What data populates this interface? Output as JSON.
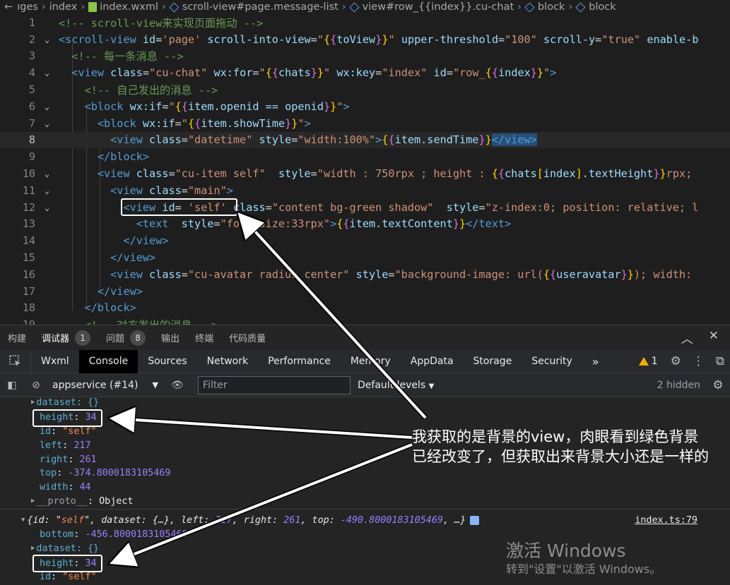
{
  "breadcrumb": {
    "items": [
      "ıges",
      "index",
      "index.wxml",
      "scroll-view#page.message-list",
      "view#row_{{index}}.cu-chat",
      "block",
      "block"
    ]
  },
  "editor": {
    "active_line": 8,
    "line_numbers": [
      "1",
      "2",
      "3",
      "4",
      "5",
      "6",
      "7",
      "8",
      "9",
      "10",
      "11",
      "12",
      "13",
      "14",
      "15",
      "16",
      "17",
      "18",
      "19"
    ]
  },
  "panel": {
    "tabs": [
      {
        "label": "构建",
        "badge": ""
      },
      {
        "label": "调试器",
        "badge": "1"
      },
      {
        "label": "问题",
        "badge": "8"
      },
      {
        "label": "输出",
        "badge": ""
      },
      {
        "label": "终端",
        "badge": ""
      },
      {
        "label": "代码质量",
        "badge": ""
      }
    ]
  },
  "devtools": {
    "tabs": [
      "Wxml",
      "Console",
      "Sources",
      "Network",
      "Performance",
      "Memory",
      "AppData",
      "Storage",
      "Security"
    ],
    "active_tab": "Console",
    "more_label": "»",
    "warning_count": "1"
  },
  "console_bar": {
    "context": "appservice (#14)",
    "filter_placeholder": "Filter",
    "levels": "Default levels",
    "hidden": "2 hidden"
  },
  "console": {
    "obj1": {
      "dataset": "dataset: {}",
      "height_key": "height",
      "height_val": "34",
      "id_key": "id",
      "id_val": "\"self\"",
      "left_key": "left",
      "left_val": "217",
      "right_key": "right",
      "right_val": "261",
      "top_key": "top",
      "top_val": "-374.8000183105469",
      "width_key": "width",
      "width_val": "44",
      "proto_key": "__proto__",
      "proto_val": "Object"
    },
    "obj2": {
      "summary_id": "self",
      "summary_left": "217",
      "summary_right": "261",
      "summary_top": "-490.8000183105469",
      "source": "index.ts:79",
      "bottom_key": "bottom",
      "bottom_val": "-456.8000183105469",
      "dataset": "dataset: {}",
      "height_key": "height",
      "height_val": "34",
      "id_key": "id",
      "id_val": "\"self\""
    }
  },
  "annotation": {
    "note": "我获取的是背景的view，肉眼看到绿色背景已经改变了，但获取出来背景大小还是一样的"
  },
  "watermark": {
    "line1": "激活 Windows",
    "line2": "转到\"设置\"以激活 Windows。"
  }
}
